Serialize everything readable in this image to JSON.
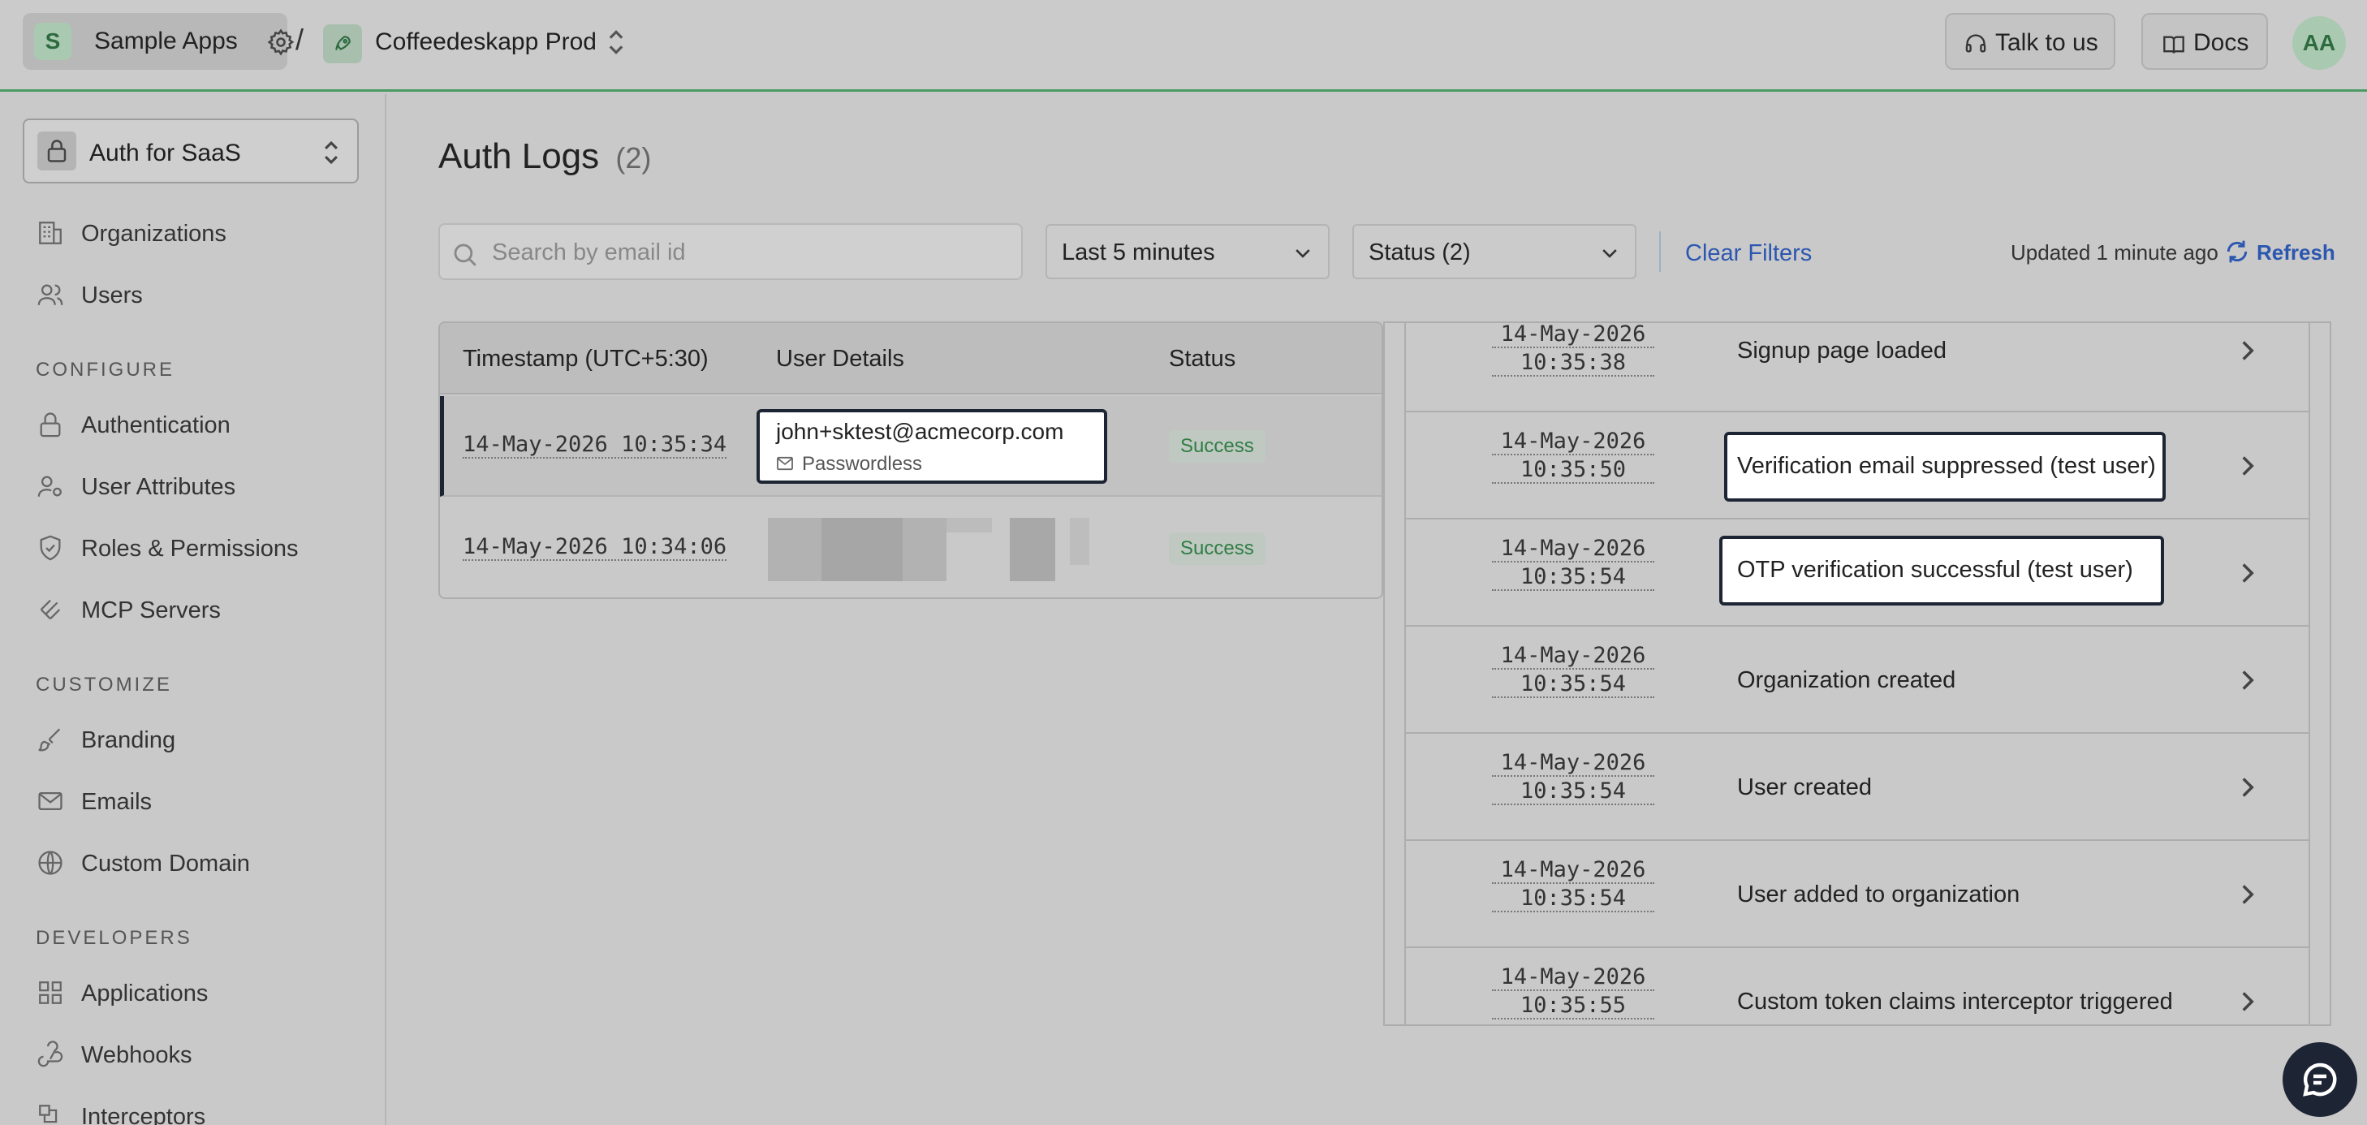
{
  "topbar": {
    "org": {
      "initial": "S",
      "name": "Sample Apps"
    },
    "separator": "/",
    "environment": {
      "name": "Coffeedeskapp Prod"
    },
    "talk_label": "Talk to us",
    "docs_label": "Docs",
    "user_initials": "AA"
  },
  "sidebar": {
    "project": "Auth for SaaS",
    "top_items": [
      {
        "label": "Organizations",
        "icon": "building-icon"
      },
      {
        "label": "Users",
        "icon": "users-icon"
      }
    ],
    "sections": [
      {
        "title": "CONFIGURE",
        "items": [
          {
            "label": "Authentication",
            "icon": "lock-icon"
          },
          {
            "label": "User Attributes",
            "icon": "user-attributes-icon"
          },
          {
            "label": "Roles & Permissions",
            "icon": "shield-icon"
          },
          {
            "label": "MCP Servers",
            "icon": "mcp-icon"
          }
        ]
      },
      {
        "title": "CUSTOMIZE",
        "items": [
          {
            "label": "Branding",
            "icon": "brush-icon"
          },
          {
            "label": "Emails",
            "icon": "mail-icon"
          },
          {
            "label": "Custom Domain",
            "icon": "globe-icon"
          }
        ]
      },
      {
        "title": "DEVELOPERS",
        "items": [
          {
            "label": "Applications",
            "icon": "grid-icon"
          },
          {
            "label": "Webhooks",
            "icon": "webhook-icon"
          },
          {
            "label": "Interceptors",
            "icon": "interceptor-icon"
          }
        ]
      }
    ]
  },
  "main": {
    "title": "Auth Logs",
    "count": "(2)",
    "search_placeholder": "Search by email id",
    "time_filter": "Last 5 minutes",
    "status_filter": "Status (2)",
    "clear_filters": "Clear Filters",
    "updated": "Updated 1 minute ago",
    "refresh": "Refresh",
    "table": {
      "headers": [
        "Timestamp (UTC+5:30)",
        "User Details",
        "Status"
      ],
      "rows": [
        {
          "timestamp": "14-May-2026 10:35:34",
          "email": "john+sktest@acmecorp.com",
          "method": "Passwordless",
          "status": "Success"
        },
        {
          "timestamp": "14-May-2026 10:34:06",
          "email": "",
          "method": "",
          "status": "Success"
        }
      ]
    },
    "events": [
      {
        "date": "14-May-2026",
        "time": "10:35:38",
        "label": "Signup page loaded"
      },
      {
        "date": "14-May-2026",
        "time": "10:35:50",
        "label": "Verification email suppressed (test user)"
      },
      {
        "date": "14-May-2026",
        "time": "10:35:54",
        "label": "OTP verification successful (test user)"
      },
      {
        "date": "14-May-2026",
        "time": "10:35:54",
        "label": "Organization created"
      },
      {
        "date": "14-May-2026",
        "time": "10:35:54",
        "label": "User created"
      },
      {
        "date": "14-May-2026",
        "time": "10:35:54",
        "label": "User added to organization"
      },
      {
        "date": "14-May-2026",
        "time": "10:35:55",
        "label": "Custom token claims interceptor triggered"
      }
    ]
  },
  "colors": {
    "accent_green": "#4d9a63",
    "link_blue": "#2c57b0",
    "success_green": "#2f7d44",
    "highlight_border": "#1d2433"
  }
}
